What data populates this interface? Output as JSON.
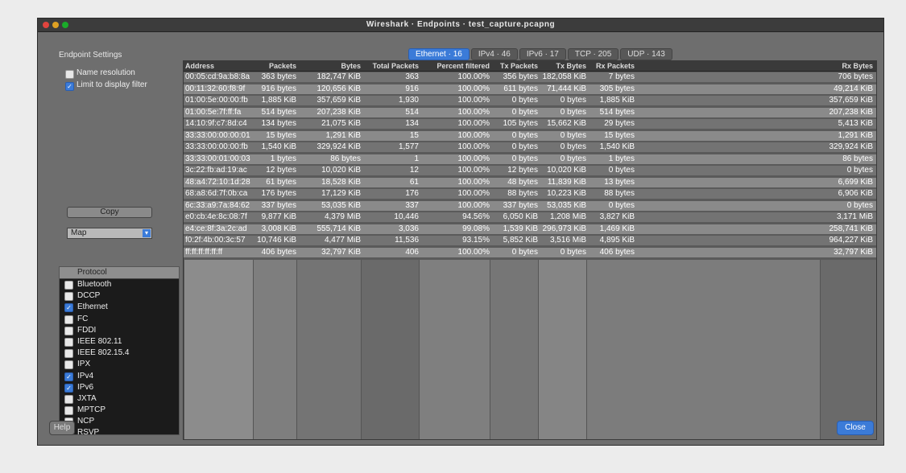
{
  "window": {
    "title": "Wireshark · Endpoints · test_capture.pcapng",
    "traffic_lights": [
      "#e0443e",
      "#dea123",
      "#1aab29"
    ]
  },
  "tabs": [
    {
      "label": "Ethernet · 16",
      "active": true
    },
    {
      "label": "IPv4 · 46",
      "active": false
    },
    {
      "label": "IPv6 · 17",
      "active": false
    },
    {
      "label": "TCP · 205",
      "active": false
    },
    {
      "label": "UDP · 143",
      "active": false
    }
  ],
  "settings": {
    "group_title": "Endpoint Settings",
    "name_resolution_label": "Name resolution",
    "name_resolution_checked": false,
    "limit_display_filter_label": "Limit to display filter",
    "limit_display_filter_checked": true,
    "copy_button": "Copy",
    "map_select": "Map"
  },
  "protocol_list": {
    "header": "Protocol",
    "items": [
      {
        "label": "Bluetooth",
        "checked": false
      },
      {
        "label": "DCCP",
        "checked": false
      },
      {
        "label": "Ethernet",
        "checked": true
      },
      {
        "label": "FC",
        "checked": false
      },
      {
        "label": "FDDI",
        "checked": false
      },
      {
        "label": "IEEE 802.11",
        "checked": false
      },
      {
        "label": "IEEE 802.15.4",
        "checked": false
      },
      {
        "label": "IPX",
        "checked": false
      },
      {
        "label": "IPv4",
        "checked": true
      },
      {
        "label": "IPv6",
        "checked": true
      },
      {
        "label": "JXTA",
        "checked": false
      },
      {
        "label": "MPTCP",
        "checked": false
      },
      {
        "label": "NCP",
        "checked": false
      },
      {
        "label": "RSVP",
        "checked": false
      }
    ]
  },
  "table": {
    "columns": [
      "Address",
      "Packets",
      "Bytes",
      "Total Packets",
      "Percent filtered",
      "Tx Packets",
      "Tx Bytes",
      "Rx Packets",
      "Rx Bytes"
    ],
    "rows": [
      [
        "00:05:cd:9a:b8:8a",
        "363 bytes",
        "182,747 KiB",
        "363",
        "100.00%",
        "356 bytes",
        "182,058 KiB",
        "7 bytes",
        "706 bytes"
      ],
      [
        "00:11:32:60:f8:9f",
        "916 bytes",
        "120,656 KiB",
        "916",
        "100.00%",
        "611 bytes",
        "71,444 KiB",
        "305 bytes",
        "49,214 KiB"
      ],
      [
        "01:00:5e:00:00:fb",
        "1,885 KiB",
        "357,659 KiB",
        "1,930",
        "100.00%",
        "0 bytes",
        "0 bytes",
        "1,885 KiB",
        "357,659 KiB"
      ],
      [
        "01:00:5e:7f:ff:fa",
        "514 bytes",
        "207,238 KiB",
        "514",
        "100.00%",
        "0 bytes",
        "0 bytes",
        "514 bytes",
        "207,238 KiB"
      ],
      [
        "14:10:9f:c7:8d:c4",
        "134 bytes",
        "21,075 KiB",
        "134",
        "100.00%",
        "105 bytes",
        "15,662 KiB",
        "29 bytes",
        "5,413 KiB"
      ],
      [
        "33:33:00:00:00:01",
        "15 bytes",
        "1,291 KiB",
        "15",
        "100.00%",
        "0 bytes",
        "0 bytes",
        "15 bytes",
        "1,291 KiB"
      ],
      [
        "33:33:00:00:00:fb",
        "1,540 KiB",
        "329,924 KiB",
        "1,577",
        "100.00%",
        "0 bytes",
        "0 bytes",
        "1,540 KiB",
        "329,924 KiB"
      ],
      [
        "33:33:00:01:00:03",
        "1 bytes",
        "86 bytes",
        "1",
        "100.00%",
        "0 bytes",
        "0 bytes",
        "1 bytes",
        "86 bytes"
      ],
      [
        "3c:22:fb:ad:19:ac",
        "12 bytes",
        "10,020 KiB",
        "12",
        "100.00%",
        "12 bytes",
        "10,020 KiB",
        "0 bytes",
        "0 bytes"
      ],
      [
        "48:a4:72:10:1d:28",
        "61 bytes",
        "18,528 KiB",
        "61",
        "100.00%",
        "48 bytes",
        "11,839 KiB",
        "13 bytes",
        "6,699 KiB"
      ],
      [
        "68:a8:6d:7f:0b:ca",
        "176 bytes",
        "17,129 KiB",
        "176",
        "100.00%",
        "88 bytes",
        "10,223 KiB",
        "88 bytes",
        "6,906 KiB"
      ],
      [
        "6c:33:a9:7a:84:62",
        "337 bytes",
        "53,035 KiB",
        "337",
        "100.00%",
        "337 bytes",
        "53,035 KiB",
        "0 bytes",
        "0 bytes"
      ],
      [
        "e0:cb:4e:8c:08:7f",
        "9,877 KiB",
        "4,379 MiB",
        "10,446",
        "94.56%",
        "6,050 KiB",
        "1,208 MiB",
        "3,827 KiB",
        "3,171 MiB"
      ],
      [
        "e4:ce:8f:3a:2c:ad",
        "3,008 KiB",
        "555,714 KiB",
        "3,036",
        "99.08%",
        "1,539 KiB",
        "296,973 KiB",
        "1,469 KiB",
        "258,741 KiB"
      ],
      [
        "f0:2f:4b:00:3c:57",
        "10,746 KiB",
        "4,477 MiB",
        "11,536",
        "93.15%",
        "5,852 KiB",
        "3,516 MiB",
        "4,895 KiB",
        "964,227 KiB"
      ],
      [
        "ff:ff:ff:ff:ff:ff",
        "406 bytes",
        "32,797 KiB",
        "406",
        "100.00%",
        "0 bytes",
        "0 bytes",
        "406 bytes",
        "32,797 KiB"
      ]
    ]
  },
  "buttons": {
    "help": "Help",
    "close": "Close"
  }
}
